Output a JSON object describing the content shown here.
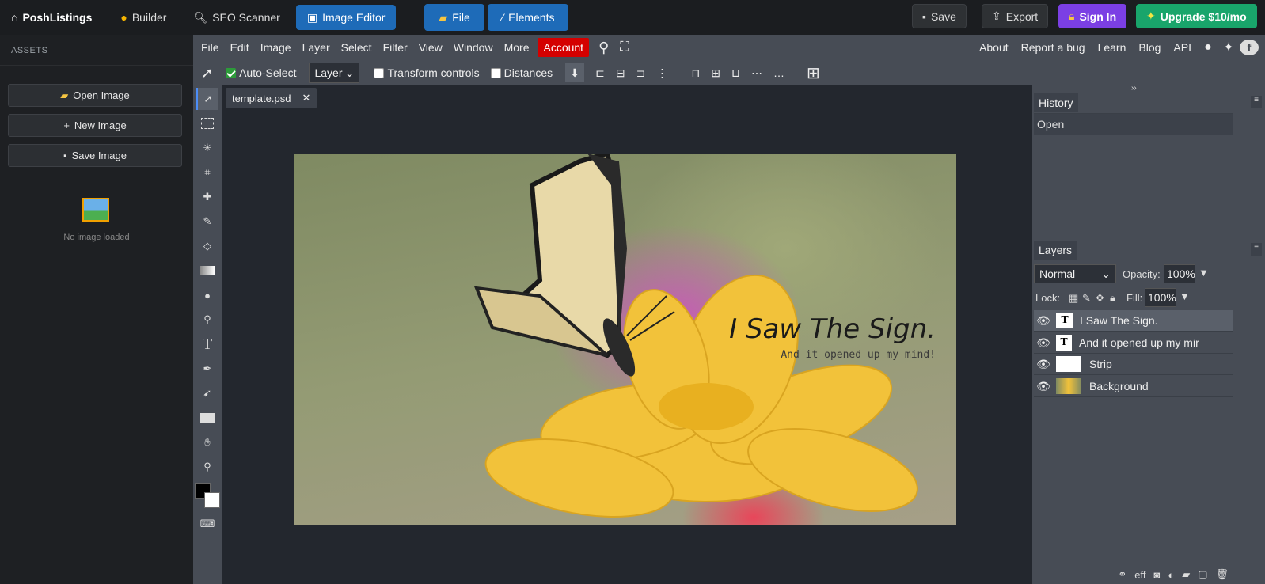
{
  "brand": {
    "name": "PoshListings"
  },
  "nav": {
    "tabs": [
      {
        "label": "Builder"
      },
      {
        "label": "SEO Scanner"
      },
      {
        "label": "Image Editor"
      }
    ],
    "file_label": "File",
    "elements_label": "Elements"
  },
  "actions": {
    "save": "Save",
    "export": "Export",
    "signin": "Sign In",
    "upgrade": "Upgrade $10/mo"
  },
  "sidebar": {
    "title": "ASSETS",
    "open": "Open Image",
    "new": "New Image",
    "save": "Save Image",
    "empty": "No image loaded"
  },
  "menu": {
    "items": [
      "File",
      "Edit",
      "Image",
      "Layer",
      "Select",
      "Filter",
      "View",
      "Window",
      "More"
    ],
    "account": "Account",
    "links": [
      "About",
      "Report a bug",
      "Learn",
      "Blog",
      "API"
    ]
  },
  "options": {
    "autoselect": "Auto-Select",
    "layer_mode": "Layer",
    "transform": "Transform controls",
    "distances": "Distances"
  },
  "document": {
    "tab": "template.psd",
    "headline": "I Saw The Sign.",
    "subline": "And it opened up my mind!"
  },
  "history": {
    "title": "History",
    "items": [
      "Open"
    ]
  },
  "layers": {
    "title": "Layers",
    "blend": "Normal",
    "opacity_label": "Opacity:",
    "opacity": "100%",
    "lock_label": "Lock:",
    "fill_label": "Fill:",
    "fill": "100%",
    "items": [
      {
        "name": "I Saw The Sign."
      },
      {
        "name": "And it opened up my mir"
      },
      {
        "name": "Strip"
      },
      {
        "name": "Background"
      }
    ]
  },
  "colors": {
    "accent": "#1e6bb8",
    "signin": "#7b3fe4",
    "upgrade": "#19a56b",
    "account": "#d40000"
  }
}
